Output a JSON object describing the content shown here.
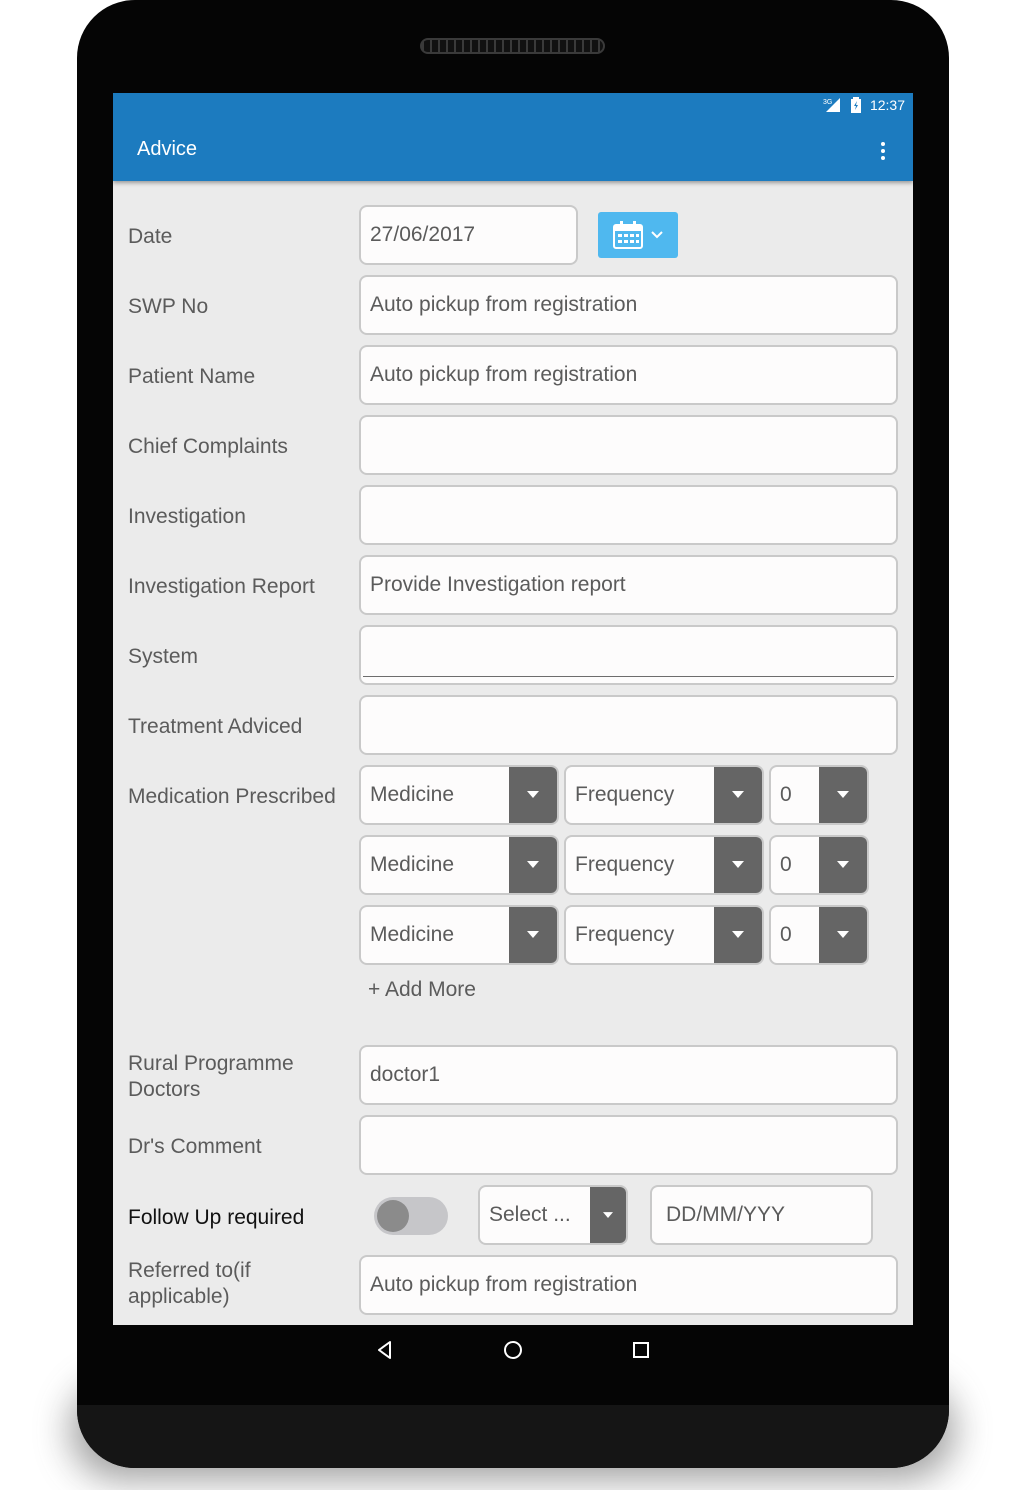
{
  "status_bar": {
    "time": "12:37",
    "network": "3G",
    "icons": [
      "signal-icon",
      "battery-icon"
    ]
  },
  "app_bar": {
    "title": "Advice",
    "menu_icon": "more-vert-icon"
  },
  "colors": {
    "app_bar": "#1c7bbf",
    "calendar_button": "#4fb8ef",
    "dropdown_arrow_bg": "#656565",
    "screen_bg": "#ebebeb"
  },
  "form": {
    "date": {
      "label": "Date",
      "value": "27/06/2017",
      "calendar_icon": "calendar-icon"
    },
    "swp_no": {
      "label": "SWP No",
      "placeholder": "Auto pickup from registration"
    },
    "patient_name": {
      "label": "Patient Name",
      "placeholder": "Auto pickup from registration"
    },
    "chief_complaints": {
      "label": "Chief Complaints",
      "value": ""
    },
    "investigation": {
      "label": "Investigation",
      "value": ""
    },
    "investigation_report": {
      "label": "Investigation Report",
      "placeholder": "Provide Investigation report"
    },
    "system": {
      "label": "System",
      "value": ""
    },
    "treatment_adviced": {
      "label": "Treatment Adviced",
      "value": ""
    },
    "medication": {
      "label": "Medication Prescribed",
      "rows": [
        {
          "medicine": "Medicine",
          "frequency": "Frequency",
          "qty": "0"
        },
        {
          "medicine": "Medicine",
          "frequency": "Frequency",
          "qty": "0"
        },
        {
          "medicine": "Medicine",
          "frequency": "Frequency",
          "qty": "0"
        }
      ],
      "add_more": "+ Add More"
    },
    "rural_doctors": {
      "label": "Rural Programme Doctors",
      "value": "doctor1"
    },
    "dr_comment": {
      "label": "Dr's Comment",
      "value": ""
    },
    "follow_up": {
      "label": "Follow Up required",
      "toggle_on": false,
      "select": "Select ...",
      "date_placeholder": "DD/MM/YYY"
    },
    "referred_to": {
      "label": "Referred to(if applicable)",
      "placeholder": "Auto pickup from registration"
    }
  },
  "nav_bar": {
    "icons": [
      "back-icon",
      "home-icon",
      "recents-icon"
    ]
  }
}
